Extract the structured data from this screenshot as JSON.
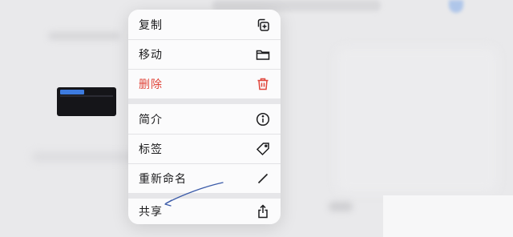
{
  "menu": {
    "items": [
      {
        "label": "复制",
        "icon": "copy-icon"
      },
      {
        "label": "移动",
        "icon": "folder-icon"
      },
      {
        "label": "删除",
        "icon": "trash-icon",
        "color": "#e0453a"
      },
      {
        "label": "简介",
        "icon": "info-icon"
      },
      {
        "label": "标签",
        "icon": "tag-icon"
      },
      {
        "label": "重新命名",
        "icon": "pencil-icon"
      },
      {
        "label": "共享",
        "icon": "share-icon"
      }
    ]
  },
  "annotation": {
    "type": "hand-drawn-arrow",
    "target": "共享",
    "color": "#3a5aa8"
  },
  "colors": {
    "destructive": "#e0453a",
    "accent": "#3d7bdf",
    "menu_bg": "#fbfbfc"
  }
}
